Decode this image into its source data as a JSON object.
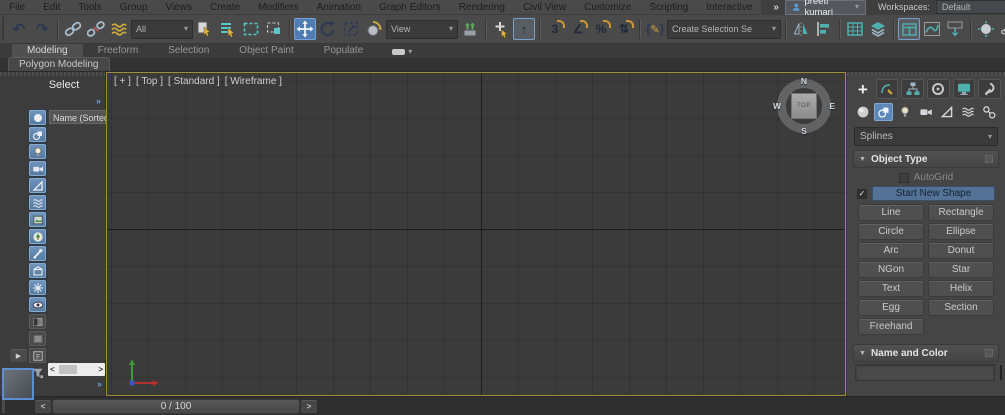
{
  "colors": {
    "accent_blue": "#5d87b8",
    "teal": "#4fb0b0",
    "gold": "#cfa43b",
    "viewport_border": "#a18c3e",
    "swatch_pink": "#d93a9e"
  },
  "menubar": {
    "items": [
      "File",
      "Edit",
      "Tools",
      "Group",
      "Views",
      "Create",
      "Modifiers",
      "Animation",
      "Graph Editors",
      "Rendering",
      "Civil View",
      "Customize",
      "Scripting",
      "Interactive"
    ],
    "user": "preeti kumari",
    "workspaces_label": "Workspaces:",
    "workspace": "Default"
  },
  "toolbar": {
    "selection_filter": "All",
    "coord_system": "View",
    "named_sets_dropdown": "Create Selection Se"
  },
  "ribbon": {
    "tabs": [
      "Modeling",
      "Freeform",
      "Selection",
      "Object Paint",
      "Populate"
    ],
    "panel_tab": "Polygon Modeling"
  },
  "explorer": {
    "title": "Select",
    "column_header": "Name (Sorted A"
  },
  "viewport": {
    "labels": [
      "[ + ]",
      "[ Top ]",
      "[ Standard ]",
      "[ Wireframe ]"
    ],
    "viewcube": {
      "n": "N",
      "e": "E",
      "s": "S",
      "w": "W",
      "top": "TOP"
    }
  },
  "command_panel": {
    "category_dropdown": "Splines",
    "rollout_object_type": {
      "title": "Object Type",
      "autogrid": "AutoGrid",
      "start_new_shape": "Start New Shape",
      "buttons": [
        "Line",
        "Rectangle",
        "Circle",
        "Ellipse",
        "Arc",
        "Donut",
        "NGon",
        "Star",
        "Text",
        "Helix",
        "Egg",
        "Section",
        "Freehand"
      ]
    },
    "rollout_name_color": {
      "title": "Name and Color",
      "name_value": ""
    }
  },
  "timeline": {
    "value": "0 / 100",
    "prev": "<",
    "next": ">"
  },
  "icons": {
    "undo": "↶",
    "redo": "↷",
    "dropdown": "▾",
    "overflow": "»",
    "kbd_override": "↑",
    "snap_3d": "3",
    "snap_angle": "∠",
    "snap_percent": "%",
    "snap_spinner": "⇅",
    "brace_l": "{",
    "pencil": "✎",
    "brace_r": "}",
    "plus": "+",
    "rollout": "▼",
    "check": "✓",
    "play": "▶",
    "chevrons": "»",
    "scroll_left": "<",
    "scroll_right": ">"
  }
}
